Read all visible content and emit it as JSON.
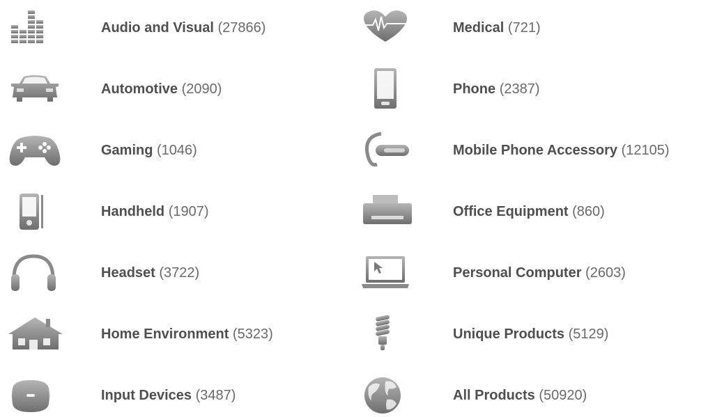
{
  "categories": [
    {
      "name": "Audio and Visual",
      "count": "(27866)",
      "icon": "equalizer-icon"
    },
    {
      "name": "Automotive",
      "count": "(2090)",
      "icon": "car-icon"
    },
    {
      "name": "Gaming",
      "count": "(1046)",
      "icon": "gamepad-icon"
    },
    {
      "name": "Handheld",
      "count": "(1907)",
      "icon": "pda-icon"
    },
    {
      "name": "Headset",
      "count": "(3722)",
      "icon": "headphones-icon"
    },
    {
      "name": "Home Environment",
      "count": "(5323)",
      "icon": "house-icon"
    },
    {
      "name": "Input Devices",
      "count": "(3487)",
      "icon": "mouse-icon"
    },
    {
      "name": "Medical",
      "count": "(721)",
      "icon": "heart-pulse-icon"
    },
    {
      "name": "Phone",
      "count": "(2387)",
      "icon": "phone-icon"
    },
    {
      "name": "Mobile Phone Accessory",
      "count": "(12105)",
      "icon": "bluetooth-earpiece-icon"
    },
    {
      "name": "Office Equipment",
      "count": "(860)",
      "icon": "printer-icon"
    },
    {
      "name": "Personal Computer",
      "count": "(2603)",
      "icon": "laptop-icon"
    },
    {
      "name": "Unique Products",
      "count": "(5129)",
      "icon": "lightbulb-icon"
    },
    {
      "name": "All Products",
      "count": "(50920)",
      "icon": "globe-icon"
    }
  ],
  "colors": {
    "name_text": "#4f4f4f",
    "count_text": "#6a6a6a",
    "icon_gray": "#8a8a8a"
  }
}
